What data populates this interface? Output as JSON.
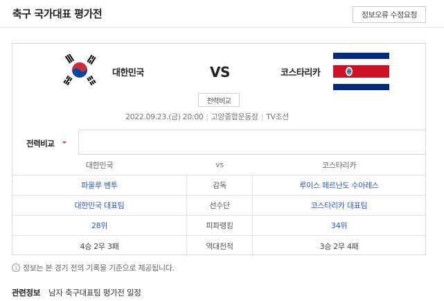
{
  "header": {
    "title": "축구 국가대표 평가전",
    "report_button": "정보오류 수정요청"
  },
  "match": {
    "home_team": "대한민국",
    "away_team": "코스타리카",
    "vs": "VS",
    "compare_button": "전력비교",
    "datetime": "2022.09.23.(금) 20:00",
    "venue": "고양종합운동장",
    "broadcaster": "TV조선"
  },
  "tabs": {
    "active": "전력비교"
  },
  "comparison": {
    "header": {
      "left": "대한민국",
      "middle": "vs",
      "right": "코스타리카"
    },
    "rows": [
      {
        "label": "감독",
        "left": "파울루 벤투",
        "right": "루이스 페르난도 수아레스",
        "link": true
      },
      {
        "label": "선수단",
        "left": "대한민국 대표팀",
        "right": "코스타리카 대표팀",
        "link": true
      },
      {
        "label": "피파랭킹",
        "left": "28위",
        "right": "34위",
        "link": true
      },
      {
        "label": "역대전적",
        "left": "4승 2무 3패",
        "right": "3승 2무 4패",
        "link": false
      }
    ]
  },
  "notice": {
    "icon": "info-icon",
    "text": "정보는 본 경기 전의 기록을 기준으로 제공됩니다."
  },
  "related": {
    "label": "관련정보",
    "link": "남자 축구대표팀 평가전 일정"
  },
  "colors": {
    "link": "#2b5ac8",
    "caret": "#e2322b",
    "kr_red": "#cd2e3a",
    "kr_blue": "#0047a0",
    "cr_blue": "#002b7f",
    "cr_red": "#ce1126"
  }
}
